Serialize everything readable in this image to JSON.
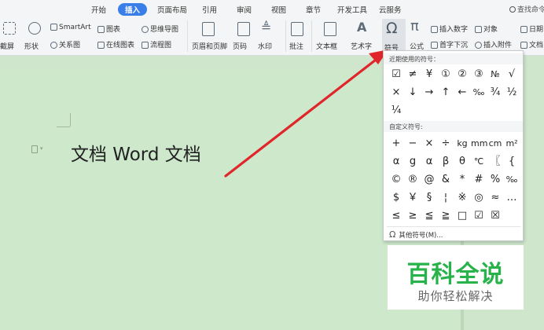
{
  "menu": {
    "tabs": [
      "开始",
      "插入",
      "页面布局",
      "引用",
      "审阅",
      "视图",
      "章节",
      "开发工具",
      "云服务"
    ],
    "active_tab": "插入",
    "search_text": "查找命令"
  },
  "ribbon": {
    "screenshot": "截屏",
    "shapes": "形状",
    "smartart": "SmartArt",
    "relationship": "关系图",
    "chart": "图表",
    "online_chart": "在线图表",
    "mindmap": "思维导图",
    "flowchart": "流程图",
    "header_footer": "页眉和页脚",
    "page_number": "页码",
    "watermark": "水印",
    "comment": "批注",
    "textbox": "文本框",
    "wordart": "艺术字",
    "symbol": "符号",
    "formula": "公式",
    "insert_number": "插入数字",
    "object": "对象",
    "dropcap": "首字下沉",
    "attachment": "插入附件",
    "date": "日期",
    "docpart": "文档"
  },
  "document": {
    "text": "文档 Word 文档"
  },
  "symbol_panel": {
    "recent_title": "近期使用的符号：",
    "recent_rows": [
      [
        "☑",
        "≠",
        "¥",
        "①",
        "②",
        "③",
        "№",
        "√"
      ],
      [
        "×",
        "↓",
        "→",
        "↑",
        "←",
        "‰",
        "¾",
        "½"
      ],
      [
        "¼"
      ]
    ],
    "custom_title": "自定义符号:",
    "custom_rows": [
      [
        "+",
        "−",
        "×",
        "÷",
        "kg",
        "mm",
        "cm",
        "m²"
      ],
      [
        "α",
        "g",
        "α",
        "β",
        "θ",
        "℃",
        "〖",
        "{"
      ],
      [
        "©",
        "®",
        "@",
        "&",
        "*",
        "#",
        "%",
        "‰"
      ],
      [
        "$",
        "￥",
        "§",
        "¦",
        "※",
        "◎",
        "≈",
        "…"
      ],
      [
        "≤",
        "≥",
        "≦",
        "≧",
        "□",
        "☑",
        "☒"
      ]
    ],
    "more_label": "其他符号(M)..."
  },
  "watermark": {
    "title": "百科全说",
    "subtitle": "助你轻松解决"
  },
  "colors": {
    "accent": "#3a7ee8",
    "arrow": "#e0262b",
    "brand_green": "#27b24a",
    "document_bg": "#cde8cb"
  }
}
